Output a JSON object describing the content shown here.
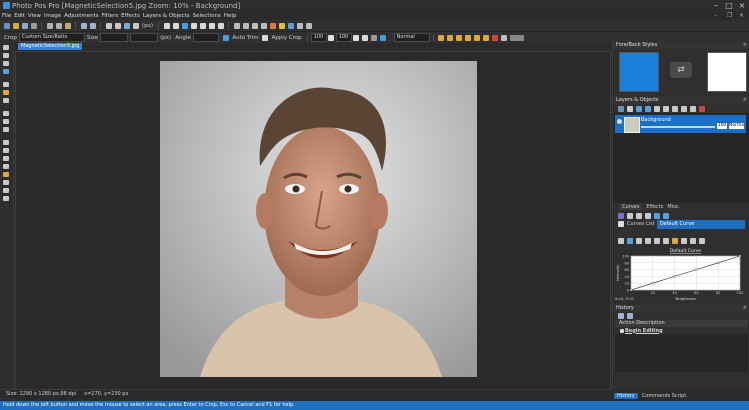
{
  "window": {
    "title": "Photo Pos Pro [MagneticSelection5.jpg Zoom: 10% - Background]"
  },
  "menu": [
    "File",
    "Edit",
    "View",
    "Image",
    "Adjustments",
    "Filters",
    "Effects",
    "Layers & Objects",
    "Selections",
    "Help"
  ],
  "options_bar": {
    "crop_label": "Crop",
    "crop_mode": "Custom Size/Ratio",
    "size_label": "Size",
    "size_unit": "(px)",
    "angle_label": "Angle",
    "auto_trim": "Auto Trim",
    "apply_crop": "Apply Crop"
  },
  "toolbar": {
    "opacity_a": "100",
    "opacity_b": "100",
    "blend_mode": "Normal",
    "zoom_preset": "(px)"
  },
  "document": {
    "tab": "MagneticSelection5.jpg"
  },
  "status": {
    "size": "Size: 1290 x 1280 px,96 dpi",
    "coords": "x=270, y=230 px",
    "hint": "Hold down the left button and move the mouse to select an area, press Enter to Crop, Esc to Cancel and F1 for help."
  },
  "panels": {
    "fore_back": {
      "title": "Fore/Back Styles",
      "fore_color": "#1a7fd8",
      "back_color": "#ffffff"
    },
    "layers": {
      "title": "Layers & Objects",
      "layer_name": "Background",
      "opacity": "100",
      "mode": "Norma"
    },
    "curves": {
      "tabs": [
        "Curves",
        "Effects",
        "Misc."
      ],
      "list_label": "Curves List",
      "curve_name": "Default Curve",
      "chart_title": "Default Curve",
      "xlabel": "Brightness",
      "ylabel": "Intensity",
      "coord_readout": "X=0, Y=0"
    },
    "history": {
      "title": "History",
      "col_header": "Action Description",
      "item": "Begin Editing"
    },
    "bottom_tabs": [
      "History",
      "Commands Script"
    ]
  },
  "chart_data": {
    "type": "line",
    "title": "Default Curve",
    "xlabel": "Brightness",
    "ylabel": "Intensity",
    "x": [
      0,
      20,
      40,
      60,
      80,
      100
    ],
    "y": [
      0,
      20,
      40,
      60,
      80,
      100
    ],
    "xticks": [
      "20",
      "40",
      "60",
      "80",
      "100"
    ],
    "yticks": [
      "0",
      "20",
      "40",
      "60",
      "80",
      "100"
    ],
    "xlim": [
      0,
      100
    ],
    "ylim": [
      0,
      100
    ],
    "grid": true
  }
}
